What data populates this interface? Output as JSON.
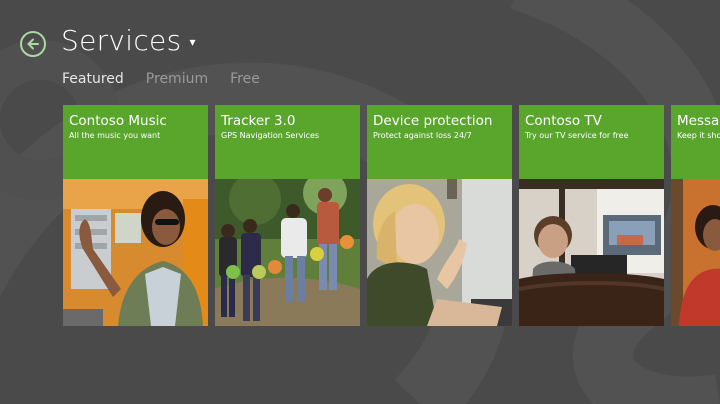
{
  "header": {
    "title": "Services",
    "chevron": "▾"
  },
  "tabs": [
    {
      "label": "Featured",
      "active": true
    },
    {
      "label": "Premium",
      "active": false
    },
    {
      "label": "Free",
      "active": false
    }
  ],
  "tiles": [
    {
      "title": "Contoso Music",
      "subtitle": "All the music you want",
      "photo_icon": "woman-sunglasses-photo"
    },
    {
      "title": "Tracker 3.0",
      "subtitle": "GPS Navigation Services",
      "photo_icon": "hikers-photo"
    },
    {
      "title": "Device protection",
      "subtitle": "Protect against loss 24/7",
      "photo_icon": "woman-laptop-photo"
    },
    {
      "title": "Contoso TV",
      "subtitle": "Try our TV service for free",
      "photo_icon": "man-watching-tv-photo"
    },
    {
      "title": "Messag",
      "subtitle": "Keep it sho",
      "photo_icon": "person-red-shirt-photo"
    }
  ],
  "colors": {
    "background": "#4a4a4a",
    "tile_accent": "#5aa62d",
    "back_ring": "#a9d8a0"
  }
}
